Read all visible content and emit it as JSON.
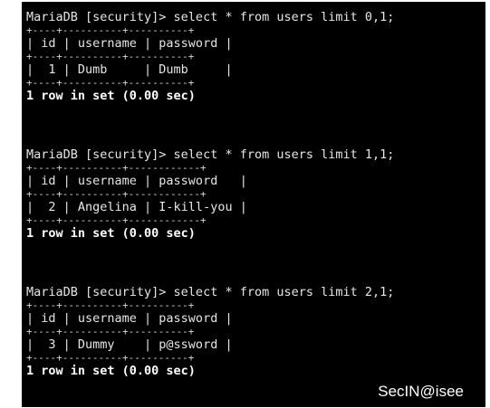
{
  "blocks": [
    {
      "prompt": "MariaDB [security]> select * from users limit 0,1;",
      "border": "+----+----------+----------+",
      "header": "| id | username | password |",
      "row": "|  1 | Dumb     | Dumb     |",
      "footer": "1 row in set (0.00 sec)"
    },
    {
      "prompt": "MariaDB [security]> select * from users limit 1,1;",
      "border": "+----+----------+------------+",
      "header": "| id | username | password   |",
      "row": "|  2 | Angelina | I-kill-you |",
      "footer": "1 row in set (0.00 sec)"
    },
    {
      "prompt": "MariaDB [security]> select * from users limit 2,1;",
      "border": "+----+----------+----------+",
      "header": "| id | username | password |",
      "row": "|  3 | Dummy    | p@ssword |",
      "footer": "1 row in set (0.00 sec)"
    }
  ],
  "watermark": "SecIN@isee"
}
